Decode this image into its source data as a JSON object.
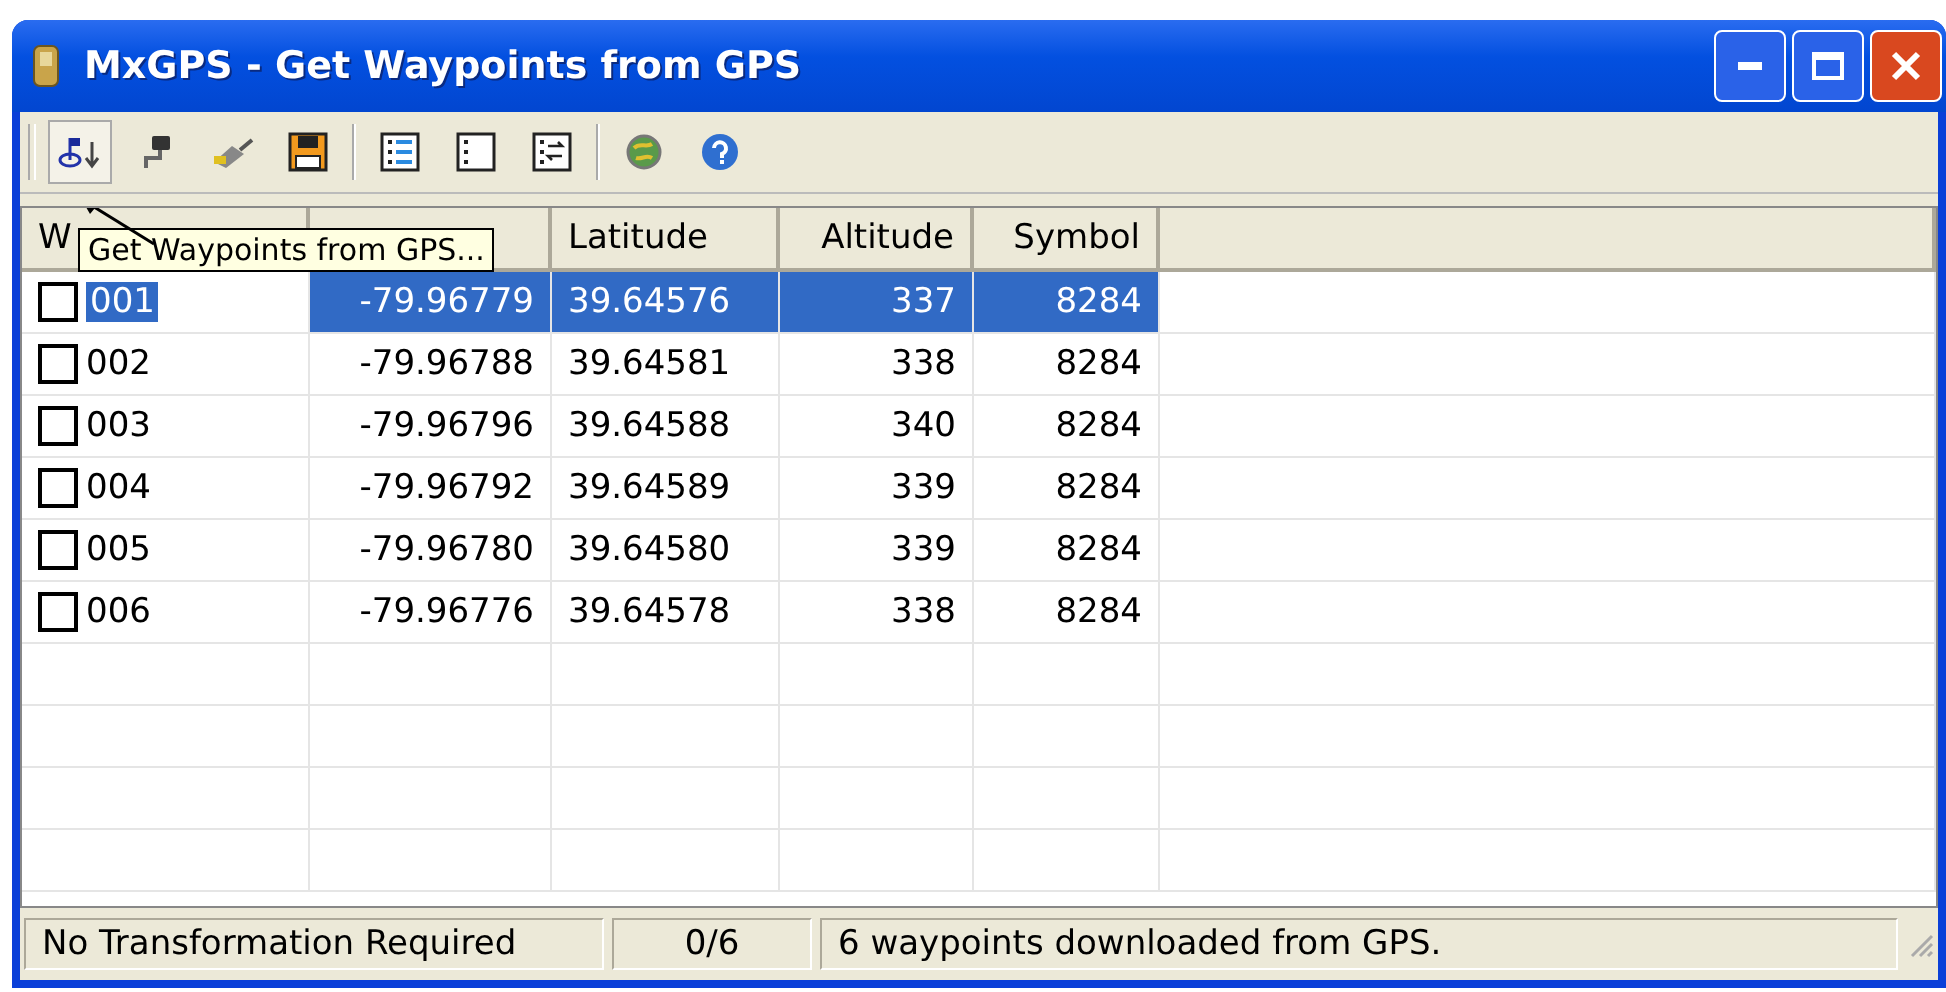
{
  "window": {
    "title": "MxGPS - Get Waypoints from GPS"
  },
  "toolbar": [
    {
      "kind": "download",
      "pressed": true
    },
    {
      "kind": "device",
      "pressed": false
    },
    {
      "kind": "cable",
      "pressed": false
    },
    {
      "kind": "save",
      "pressed": false
    },
    {
      "kind": "sep"
    },
    {
      "kind": "list",
      "pressed": false
    },
    {
      "kind": "blank",
      "pressed": false
    },
    {
      "kind": "convert",
      "pressed": false
    },
    {
      "kind": "sep"
    },
    {
      "kind": "globe",
      "pressed": false
    },
    {
      "kind": "help",
      "pressed": false
    }
  ],
  "tooltip": "Get Waypoints from GPS...",
  "table": {
    "columns": [
      "W",
      null,
      "Latitude",
      "Altitude",
      "Symbol"
    ],
    "rows": [
      {
        "selected": true,
        "checked": false,
        "cells": [
          "001",
          "-79.96779",
          "39.64576",
          "337",
          "8284"
        ]
      },
      {
        "selected": false,
        "checked": false,
        "cells": [
          "002",
          "-79.96788",
          "39.64581",
          "338",
          "8284"
        ]
      },
      {
        "selected": false,
        "checked": false,
        "cells": [
          "003",
          "-79.96796",
          "39.64588",
          "340",
          "8284"
        ]
      },
      {
        "selected": false,
        "checked": false,
        "cells": [
          "004",
          "-79.96792",
          "39.64589",
          "339",
          "8284"
        ]
      },
      {
        "selected": false,
        "checked": false,
        "cells": [
          "005",
          "-79.96780",
          "39.64580",
          "339",
          "8284"
        ]
      },
      {
        "selected": false,
        "checked": false,
        "cells": [
          "006",
          "-79.96776",
          "39.64578",
          "338",
          "8284"
        ]
      }
    ]
  },
  "status_bar": [
    "No Transformation Required",
    "0/6",
    "6 waypoints downloaded from GPS."
  ]
}
